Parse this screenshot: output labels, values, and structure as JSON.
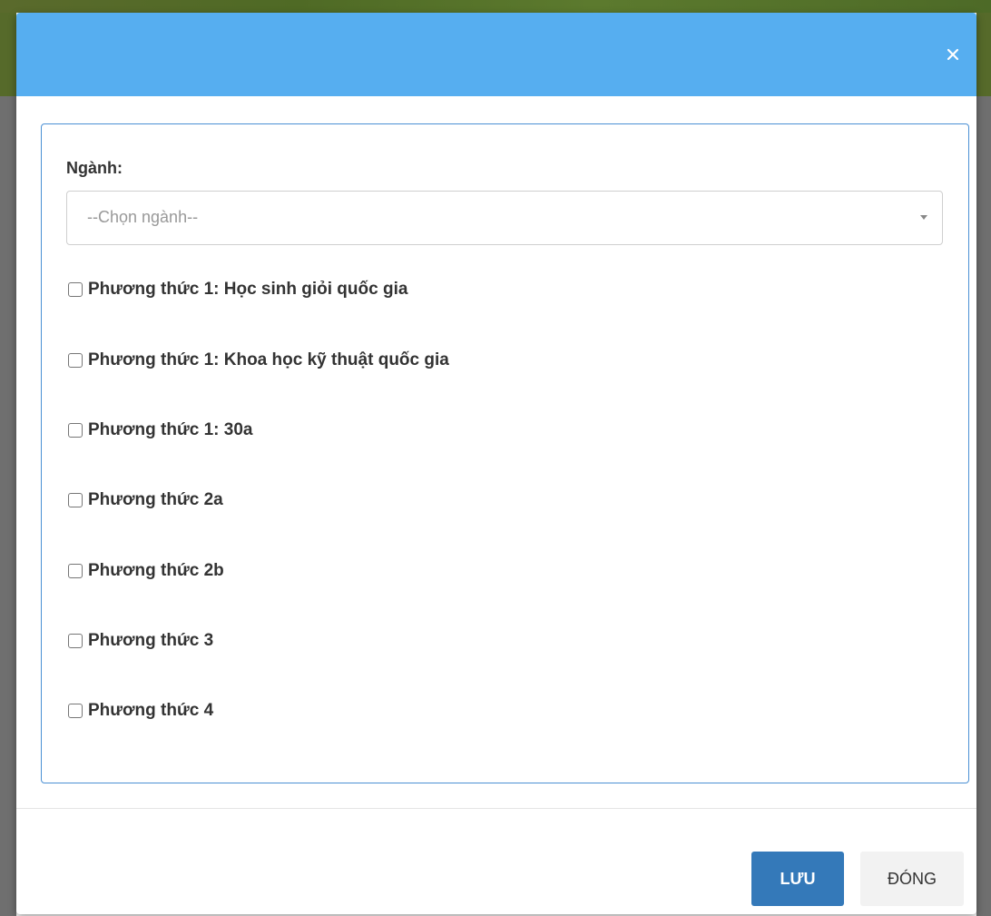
{
  "colors": {
    "header": "#56aef0",
    "panel_border": "#4a90d4",
    "save_button": "#3479b9",
    "close_button": "#f2f2f2"
  },
  "header": {
    "close_icon": "close-icon"
  },
  "form": {
    "label": "Ngành:",
    "select_placeholder": "--Chọn ngành--",
    "options": [
      {
        "label": "Phương thức 1: Học sinh giỏi quốc gia",
        "checked": false
      },
      {
        "label": "Phương thức 1: Khoa học kỹ thuật quốc gia",
        "checked": false
      },
      {
        "label": "Phương thức 1: 30a",
        "checked": false
      },
      {
        "label": "Phương thức 2a",
        "checked": false
      },
      {
        "label": "Phương thức 2b",
        "checked": false
      },
      {
        "label": "Phương thức 3",
        "checked": false
      },
      {
        "label": "Phương thức 4",
        "checked": false
      }
    ]
  },
  "footer": {
    "save_label": "LƯU",
    "close_label": "ĐÓNG"
  }
}
